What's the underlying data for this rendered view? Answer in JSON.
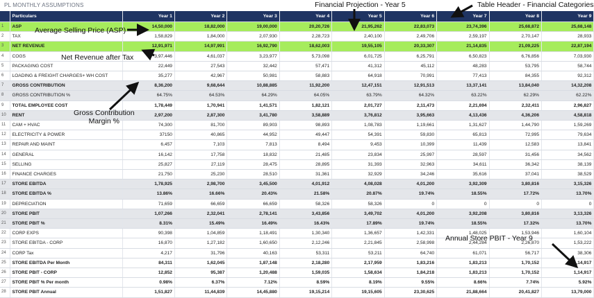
{
  "sheet_title": "PL MONTHLY ASSUMPTIONS",
  "header": {
    "particulars": "Particulars",
    "years": [
      "Year 1",
      "Year 2",
      "Year 3",
      "Year 4",
      "Year 5",
      "Year 6",
      "Year 7",
      "Year 8",
      "Year 9"
    ]
  },
  "rows": [
    {
      "n": "1",
      "name": "ASP",
      "style": "green",
      "vals": [
        "14,50,000",
        "18,82,000",
        "19,00,000",
        "20,20,726",
        "21,95,262",
        "22,83,073",
        "23,74,396",
        "25,68,872",
        "25,68,148"
      ]
    },
    {
      "n": "2",
      "name": "TAX",
      "style": "",
      "vals": [
        "1,58,829",
        "1,84,000",
        "2,07,930",
        "2,28,723",
        "2,40,100",
        "2,49,706",
        "2,59,197",
        "2,70,147",
        "28,933"
      ]
    },
    {
      "n": "3",
      "name": "NET REVENUE",
      "style": "green",
      "vals": [
        "12,91,971",
        "14,97,991",
        "16,92,790",
        "18,62,003",
        "19,55,105",
        "20,33,307",
        "21,14,835",
        "21,09,225",
        "22,87,194"
      ]
    },
    {
      "n": "4",
      "name": "COGS",
      "style": "",
      "vals": [
        "3,97,446",
        "4,61,037",
        "3,23,977",
        "5,73,098",
        "6,01,725",
        "6,25,791",
        "6,50,823",
        "6,76,856",
        "7,03,930"
      ]
    },
    {
      "n": "5",
      "name": "PACKAGING COST",
      "style": "",
      "vals": [
        "22,449",
        "27,543",
        "32,442",
        "57,471",
        "41,312",
        "45,112",
        "48,283",
        "53,795",
        "58,744"
      ]
    },
    {
      "n": "6",
      "name": "LOADING & FREIGHT CHARGES+ WH COST",
      "style": "",
      "vals": [
        "35,277",
        "42,967",
        "50,981",
        "58,883",
        "64,918",
        "70,991",
        "77,413",
        "84,355",
        "92,312"
      ]
    },
    {
      "n": "7",
      "name": "GROSS CONTRIBUTION",
      "style": "gray",
      "vals": [
        "8,36,200",
        "9,68,644",
        "10,88,885",
        "11,92,200",
        "12,47,151",
        "12,91,513",
        "13,37,141",
        "13,84,040",
        "14,32,208"
      ]
    },
    {
      "n": "8",
      "name": "GROSS CONTRIBUTION %",
      "style": "gray-light",
      "vals": [
        "64.75%",
        "64.53%",
        "64.29%",
        "64.05%",
        "63.79%",
        "64.32%",
        "63.22%",
        "62.29%",
        "62.22%"
      ]
    },
    {
      "n": "9",
      "name": "TOTAL EMPLOYEE COST",
      "style": "bold",
      "vals": [
        "1,78,449",
        "1,70,941",
        "1,41,571",
        "1,82,121",
        "2,01,727",
        "2,11,473",
        "2,21,694",
        "2,32,411",
        "2,96,827"
      ]
    },
    {
      "n": "10",
      "name": "RENT",
      "style": "gray",
      "vals": [
        "2,97,200",
        "2,87,300",
        "3,41,780",
        "3,58,889",
        "3,76,812",
        "3,95,663",
        "4,13,436",
        "4,36,206",
        "4,58,818"
      ]
    },
    {
      "n": "11",
      "name": "CAM + HVAC",
      "style": "",
      "vals": [
        "74,300",
        "81,700",
        "89,903",
        "98,893",
        "1,08,783",
        "1,19,661",
        "1,31,627",
        "1,44,790",
        "1,59,269"
      ]
    },
    {
      "n": "12",
      "name": "ELECTRICITY & POWER",
      "style": "",
      "vals": [
        "37150",
        "40,865",
        "44,952",
        "49,447",
        "54,391",
        "59,830",
        "65,813",
        "72,995",
        "79,634"
      ]
    },
    {
      "n": "13",
      "name": "REPAIR AND MAINT",
      "style": "",
      "vals": [
        "6,457",
        "7,103",
        "7,813",
        "8,494",
        "9,453",
        "10,399",
        "11,439",
        "12,583",
        "13,841"
      ]
    },
    {
      "n": "14",
      "name": "GENERAL",
      "style": "",
      "vals": [
        "16,142",
        "17,758",
        "18,832",
        "21,485",
        "23,834",
        "25,997",
        "28,597",
        "31,456",
        "34,562"
      ]
    },
    {
      "n": "15",
      "name": "SELLING",
      "style": "",
      "vals": [
        "25,827",
        "27,119",
        "28,475",
        "28,895",
        "31,393",
        "32,963",
        "34,611",
        "36,342",
        "38,139"
      ]
    },
    {
      "n": "16",
      "name": "FINANCE CHARGES",
      "style": "",
      "vals": [
        "21,750",
        "25,230",
        "28,510",
        "31,361",
        "32,929",
        "34,246",
        "35,616",
        "37,041",
        "38,529"
      ]
    },
    {
      "n": "17",
      "name": "STORE EBITDA",
      "style": "gray",
      "vals": [
        "1,78,925",
        "2,98,700",
        "3,45,500",
        "4,01,912",
        "4,08,028",
        "4,01,200",
        "3,92,309",
        "3,80,816",
        "3,15,326"
      ]
    },
    {
      "n": "18",
      "name": "STORE EBITDA %",
      "style": "gray",
      "vals": [
        "13.86%",
        "16.66%",
        "20.43%",
        "21.58%",
        "20.87%",
        "19.74%",
        "18.55%",
        "17.72%",
        "13.70%"
      ]
    },
    {
      "n": "19",
      "name": "DEPRECIATION",
      "style": "",
      "vals": [
        "71,659",
        "66,659",
        "66,659",
        "58,326",
        "58,326",
        "0",
        "0",
        "0",
        "0"
      ]
    },
    {
      "n": "20",
      "name": "STORE PBIT",
      "style": "gray",
      "vals": [
        "1,07,266",
        "2,32,041",
        "2,78,141",
        "3,43,856",
        "3,49,702",
        "4,01,200",
        "3,92,208",
        "3,80,816",
        "3,13,326"
      ]
    },
    {
      "n": "21",
      "name": "STORE PBIT %",
      "style": "gray",
      "vals": [
        "8.31%",
        "15.49%",
        "16.49%",
        "16.43%",
        "17.89%",
        "19.74%",
        "18.55%",
        "17.32%",
        "13.70%"
      ]
    },
    {
      "n": "22",
      "name": "CORP EXPS",
      "style": "",
      "vals": [
        "90,398",
        "1,04,859",
        "1,18,491",
        "1,30,340",
        "1,36,657",
        "1,42,331",
        "1,48,025",
        "1,53,946",
        "1,60,104"
      ]
    },
    {
      "n": "23",
      "name": "STORE EBITDA - CORP",
      "style": "",
      "vals": [
        "16,870",
        "1,27,182",
        "1,60,650",
        "2,12,246",
        "2,21,845",
        "2,58,998",
        "2,44,284",
        "2,26,870",
        "1,53,222"
      ]
    },
    {
      "n": "24",
      "name": "CORP Tax",
      "style": "",
      "vals": [
        "4,217",
        "31,796",
        "40,163",
        "53,311",
        "53,211",
        "64,740",
        "61,071",
        "56,717",
        "38,306"
      ]
    },
    {
      "n": "25",
      "name": "STORE EBITDA Per Month",
      "style": "bold",
      "vals": [
        "84,311",
        "1,62,045",
        "1,87,148",
        "2,18,280",
        "2,17,959",
        "1,83,216",
        "1,83,213",
        "1,70,152",
        "1,14,917"
      ]
    },
    {
      "n": "26",
      "name": "STORE PBIT - CORP",
      "style": "bold",
      "vals": [
        "12,852",
        "95,387",
        "1,20,488",
        "1,59,035",
        "1,58,634",
        "1,84,218",
        "1,83,213",
        "1,70,152",
        "1,14,917"
      ]
    },
    {
      "n": "27",
      "name": "STORE PBIT % Per month",
      "style": "bold",
      "vals": [
        "0.98%",
        "6.37%",
        "7.12%",
        "8.59%",
        "8.19%",
        "9.55%",
        "8.66%",
        "7.74%",
        "5.92%"
      ]
    },
    {
      "n": "28",
      "name": "STORE PBIT Annual",
      "style": "bold",
      "vals": [
        "1,51,827",
        "11,44,839",
        "14,45,880",
        "19,15,214",
        "19,15,605",
        "23,30,625",
        "21,88,664",
        "20,41,827",
        "13,79,000"
      ]
    }
  ],
  "annotations": {
    "asp": "Average Selling Price (ASP)",
    "financial_projection": "Financial Projection - Year 5",
    "table_header": "Table Header - Financial Categories",
    "net_revenue": "Net Revenue after Tax",
    "gross_contribution_1": "Gross Contribution",
    "gross_contribution_2": "Margin %",
    "annual_pbit": "Annual Store PBIT - Year 9"
  },
  "colors": {
    "header_bg": "#1f3462",
    "highlight_green": "#a6ec5c",
    "subtotal_gray": "#e4e6ea"
  }
}
